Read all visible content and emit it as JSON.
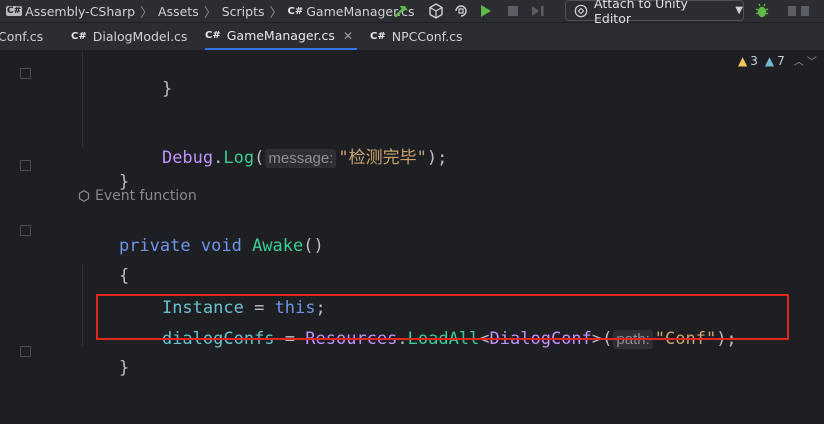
{
  "toolbar": {
    "breadcrumb": [
      "Assembly-CSharp",
      "Assets",
      "Scripts",
      "GameManager.cs"
    ],
    "attach_label": "Attach to Unity Editor",
    "cs_badge": "C#"
  },
  "tabs": [
    {
      "label": "Conf.cs",
      "active": false
    },
    {
      "label": "DialogModel.cs",
      "active": false
    },
    {
      "label": "GameManager.cs",
      "active": true
    },
    {
      "label": "NPCConf.cs",
      "active": false
    }
  ],
  "editor": {
    "warnings_count": "3",
    "weak_warnings_count": "7",
    "event_hint": "Event function",
    "lines": {
      "close_brace_inner": "}",
      "debug_obj": "Debug",
      "debug_method": "Log",
      "debug_hint": "message:",
      "debug_string": "\"检测完毕\"",
      "close_brace_outer": "}",
      "kw_private": "private",
      "kw_void": "void",
      "method_name": "Awake",
      "open_brace": "{",
      "instance_prop": "Instance",
      "kw_this": "this",
      "field_name": "dialogConfs",
      "resources_obj": "Resources",
      "loadall_method": "LoadAll",
      "generic_type": "DialogConf",
      "path_hint": "path:",
      "conf_string": "\"Conf\"",
      "close_brace_method": "}"
    }
  },
  "colors": {
    "keyword": "#6c95eb",
    "method": "#39cc9b",
    "type": "#c191ff",
    "string": "#c9a26d",
    "highlight_box": "#e0261f"
  }
}
